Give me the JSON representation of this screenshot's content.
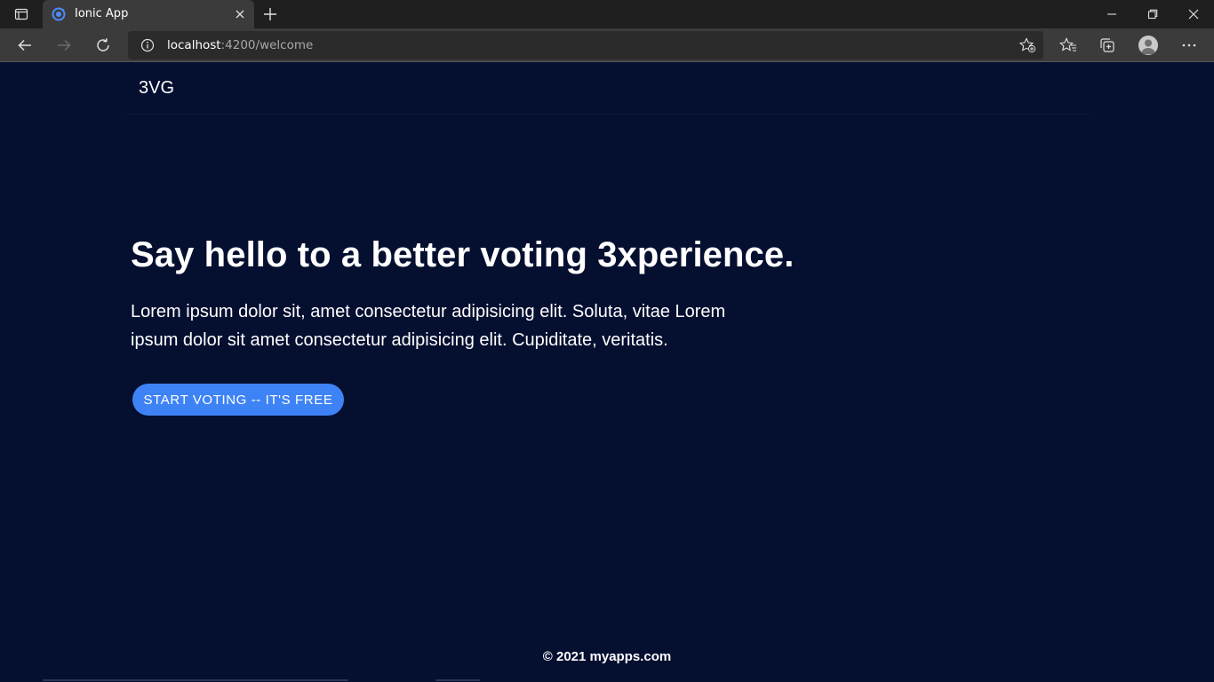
{
  "browser": {
    "tab": {
      "title": "Ionic App",
      "favicon": "ionic-logo-icon",
      "close_icon": "close-icon"
    },
    "tab_actions_icon": "tab-actions-icon",
    "new_tab_icon": "plus-icon",
    "window_controls": [
      "minimize-icon",
      "restore-icon",
      "close-icon"
    ],
    "toolbar": {
      "back_icon": "back-arrow-icon",
      "forward_icon": "forward-arrow-icon",
      "refresh_icon": "refresh-icon",
      "url_host": "localhost",
      "url_rest": ":4200/welcome",
      "site_info_icon": "info-icon",
      "add_favorite_icon": "star-add-icon",
      "favorites_icon": "favorites-icon",
      "collections_icon": "collections-icon",
      "profile_icon": "avatar-icon",
      "menu_icon": "more-icon"
    }
  },
  "app": {
    "brand": "3VG",
    "hero": {
      "title": "Say hello to a better voting 3xperience.",
      "text": "Lorem ipsum dolor sit, amet consectetur adipisicing elit. Soluta, vitae Lorem ipsum dolor sit amet consectetur adipisicing elit. Cupiditate, veritatis.",
      "cta_label": "START VOTING -- IT'S FREE"
    },
    "footer": "© 2021 myapps.com"
  },
  "colors": {
    "page_background": "#050f30",
    "button": "#3e83f5",
    "text": "#ffffff"
  }
}
